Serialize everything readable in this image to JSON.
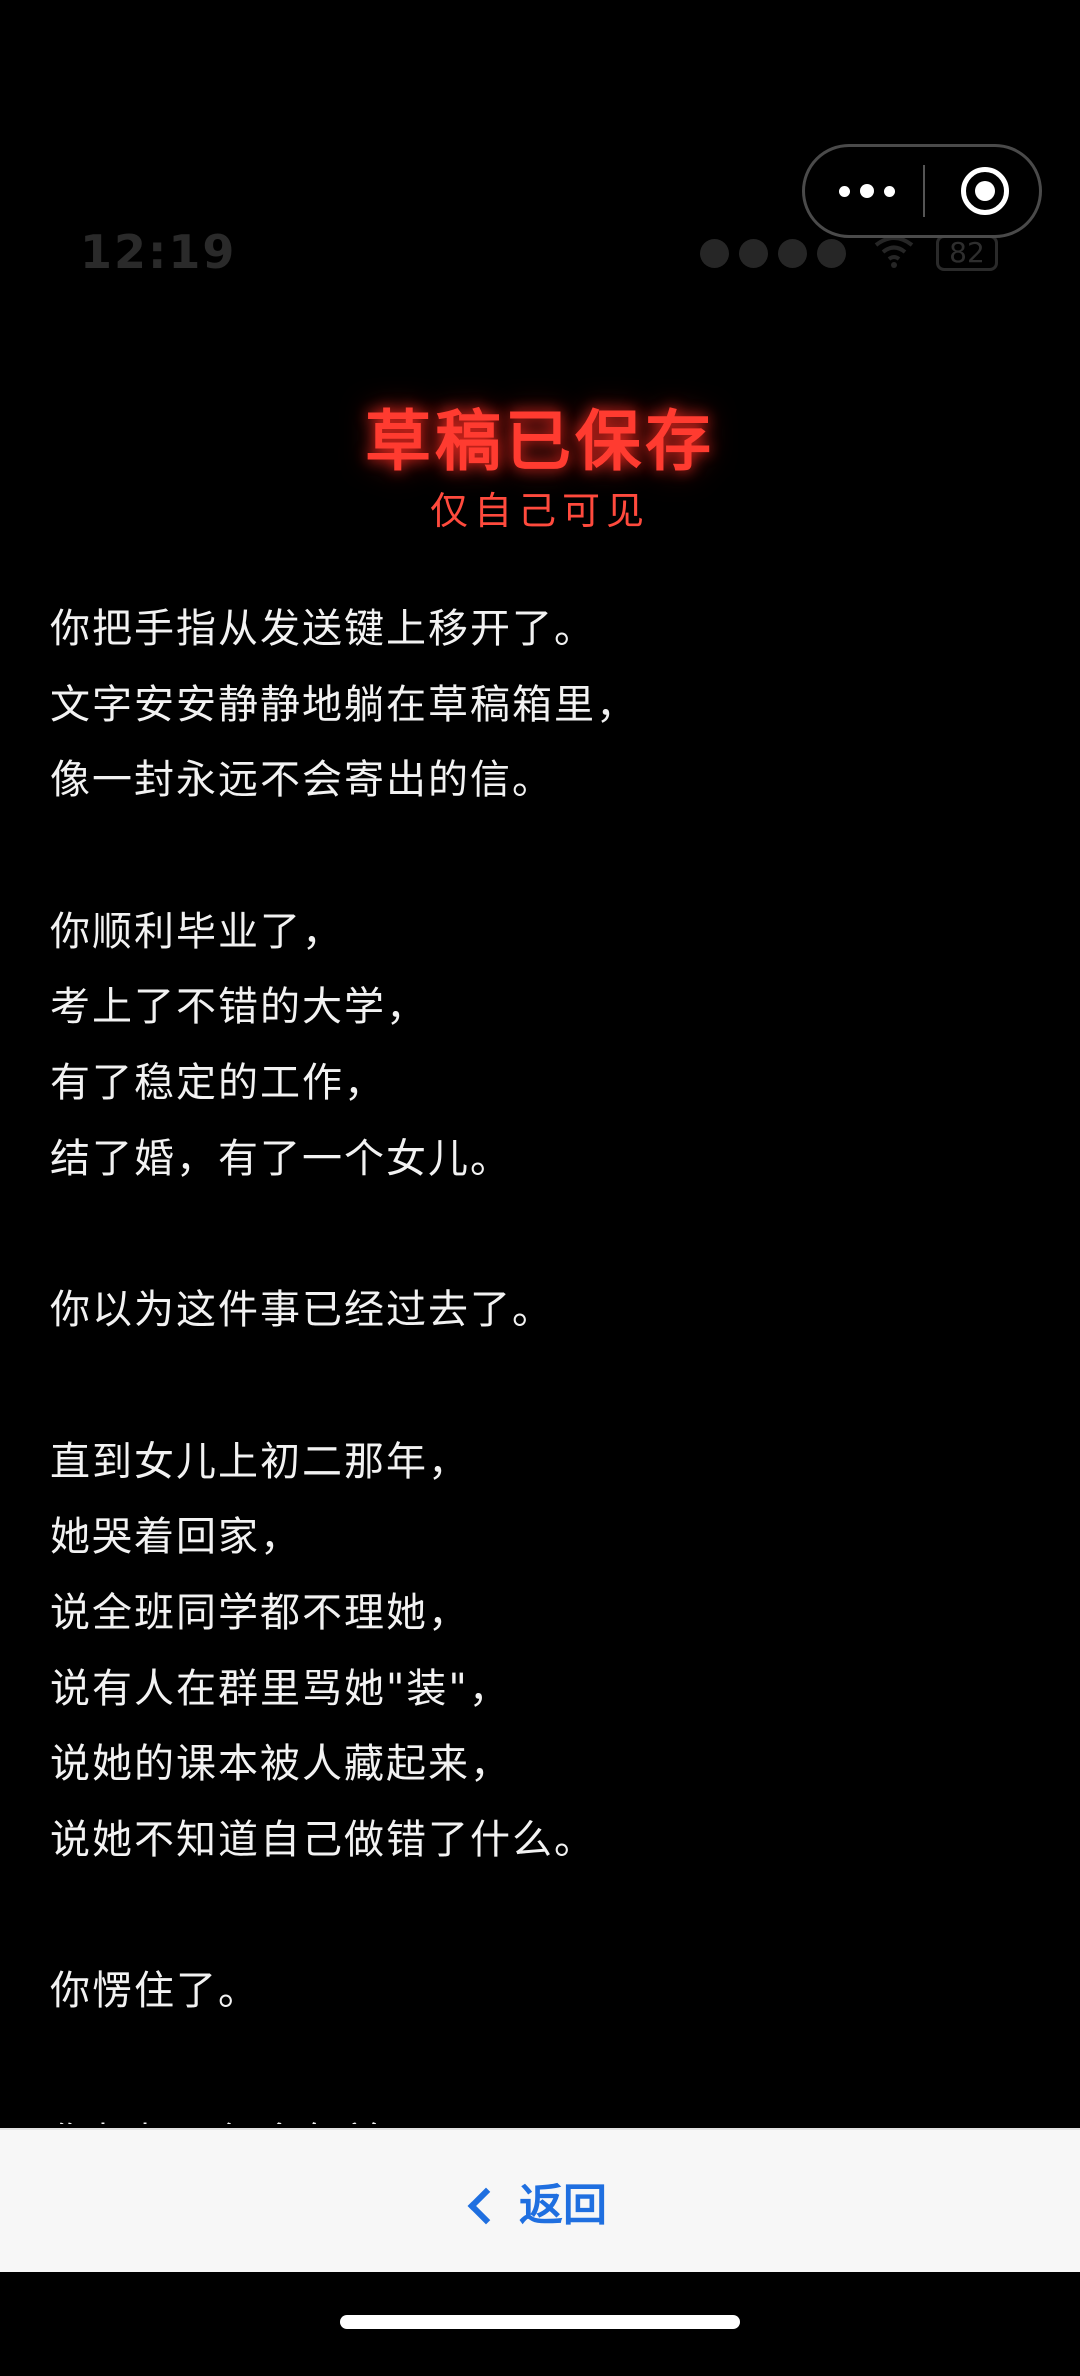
{
  "status_bar": {
    "time": "12:19",
    "battery": "82"
  },
  "header": {
    "title": "草稿已保存",
    "subtitle": "仅自己可见"
  },
  "body": {
    "lines": [
      "你把手指从发送键上移开了。",
      "文字安安静静地躺在草稿箱里，",
      "像一封永远不会寄出的信。",
      "",
      "你顺利毕业了，",
      "考上了不错的大学，",
      "有了稳定的工作，",
      "结了婚，有了一个女儿。",
      "",
      "你以为这件事已经过去了。",
      "",
      "直到女儿上初二那年，",
      "她哭着回家，",
      "说全班同学都不理她，",
      "说有人在群里骂她\"装\"，",
      "说她的课本被人藏起来，",
      "说她不知道自己做错了什么。",
      "",
      "你愣住了。",
      "",
      "你想起了很多年前"
    ]
  },
  "bottom_bar": {
    "back_label": "返回"
  },
  "colors": {
    "title_red": "#ff3b30",
    "link_blue": "#1f6fe0",
    "background": "#000000"
  },
  "icons": {
    "capsule_more": "more-dots-icon",
    "capsule_close": "target-close-icon",
    "back": "chevron-left-icon"
  }
}
